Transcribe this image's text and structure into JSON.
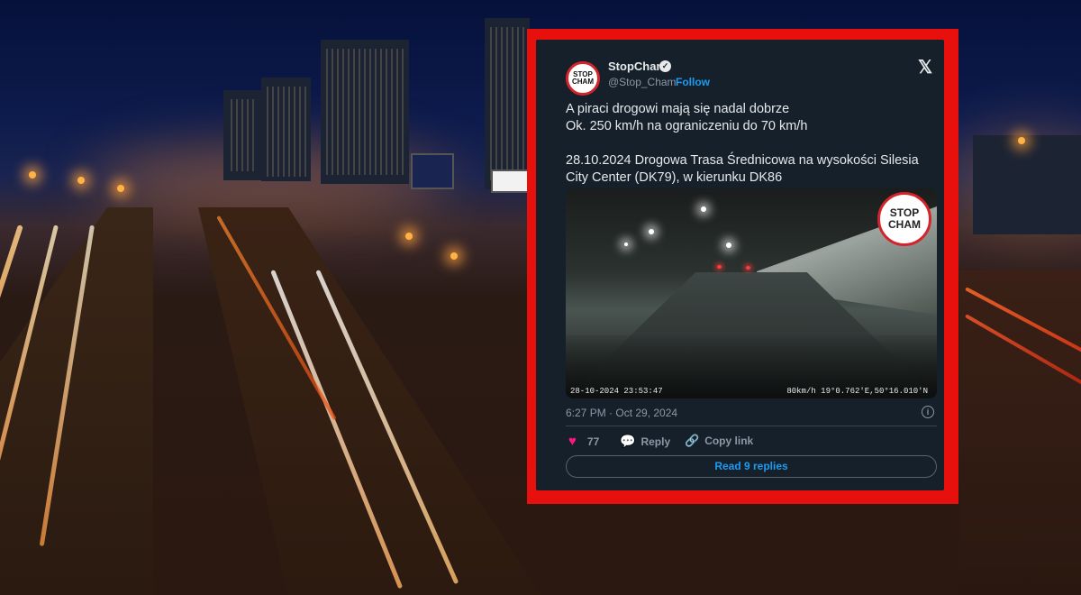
{
  "tweet": {
    "avatar_text": "STOP\nCHAM",
    "name": "StopCham",
    "handle": "@Stop_Cham",
    "follow_label": "Follow",
    "separator": "·",
    "x_logo": "𝕏",
    "text": "A piraci drogowi mają się nadal dobrze\nOk. 250 km/h na ograniczeniu do 70 km/h\n\n28.10.2024 Drogowa Trasa Średnicowa na wysokości Silesia City Center (DK79), w kierunku DK86",
    "video": {
      "logo_text": "STOP\nCHAM",
      "timestamp": "28-10-2024 23:53:47",
      "speed_coords": "80km/h 19°0.762'E,50°16.010'N"
    },
    "time": "6:27 PM · Oct 29, 2024",
    "info_icon": "i",
    "likes": "77",
    "reply_label": "Reply",
    "copy_link_label": "Copy link",
    "read_replies_label": "Read 9 replies"
  },
  "colors": {
    "frame": "#e8100d",
    "card_bg": "#15202b",
    "accent": "#1d9bf0",
    "like": "#f91880"
  },
  "icons": {
    "verified": "verified-badge-icon",
    "like": "heart-icon",
    "reply": "reply-icon",
    "copy_link": "link-icon",
    "info": "info-icon"
  }
}
